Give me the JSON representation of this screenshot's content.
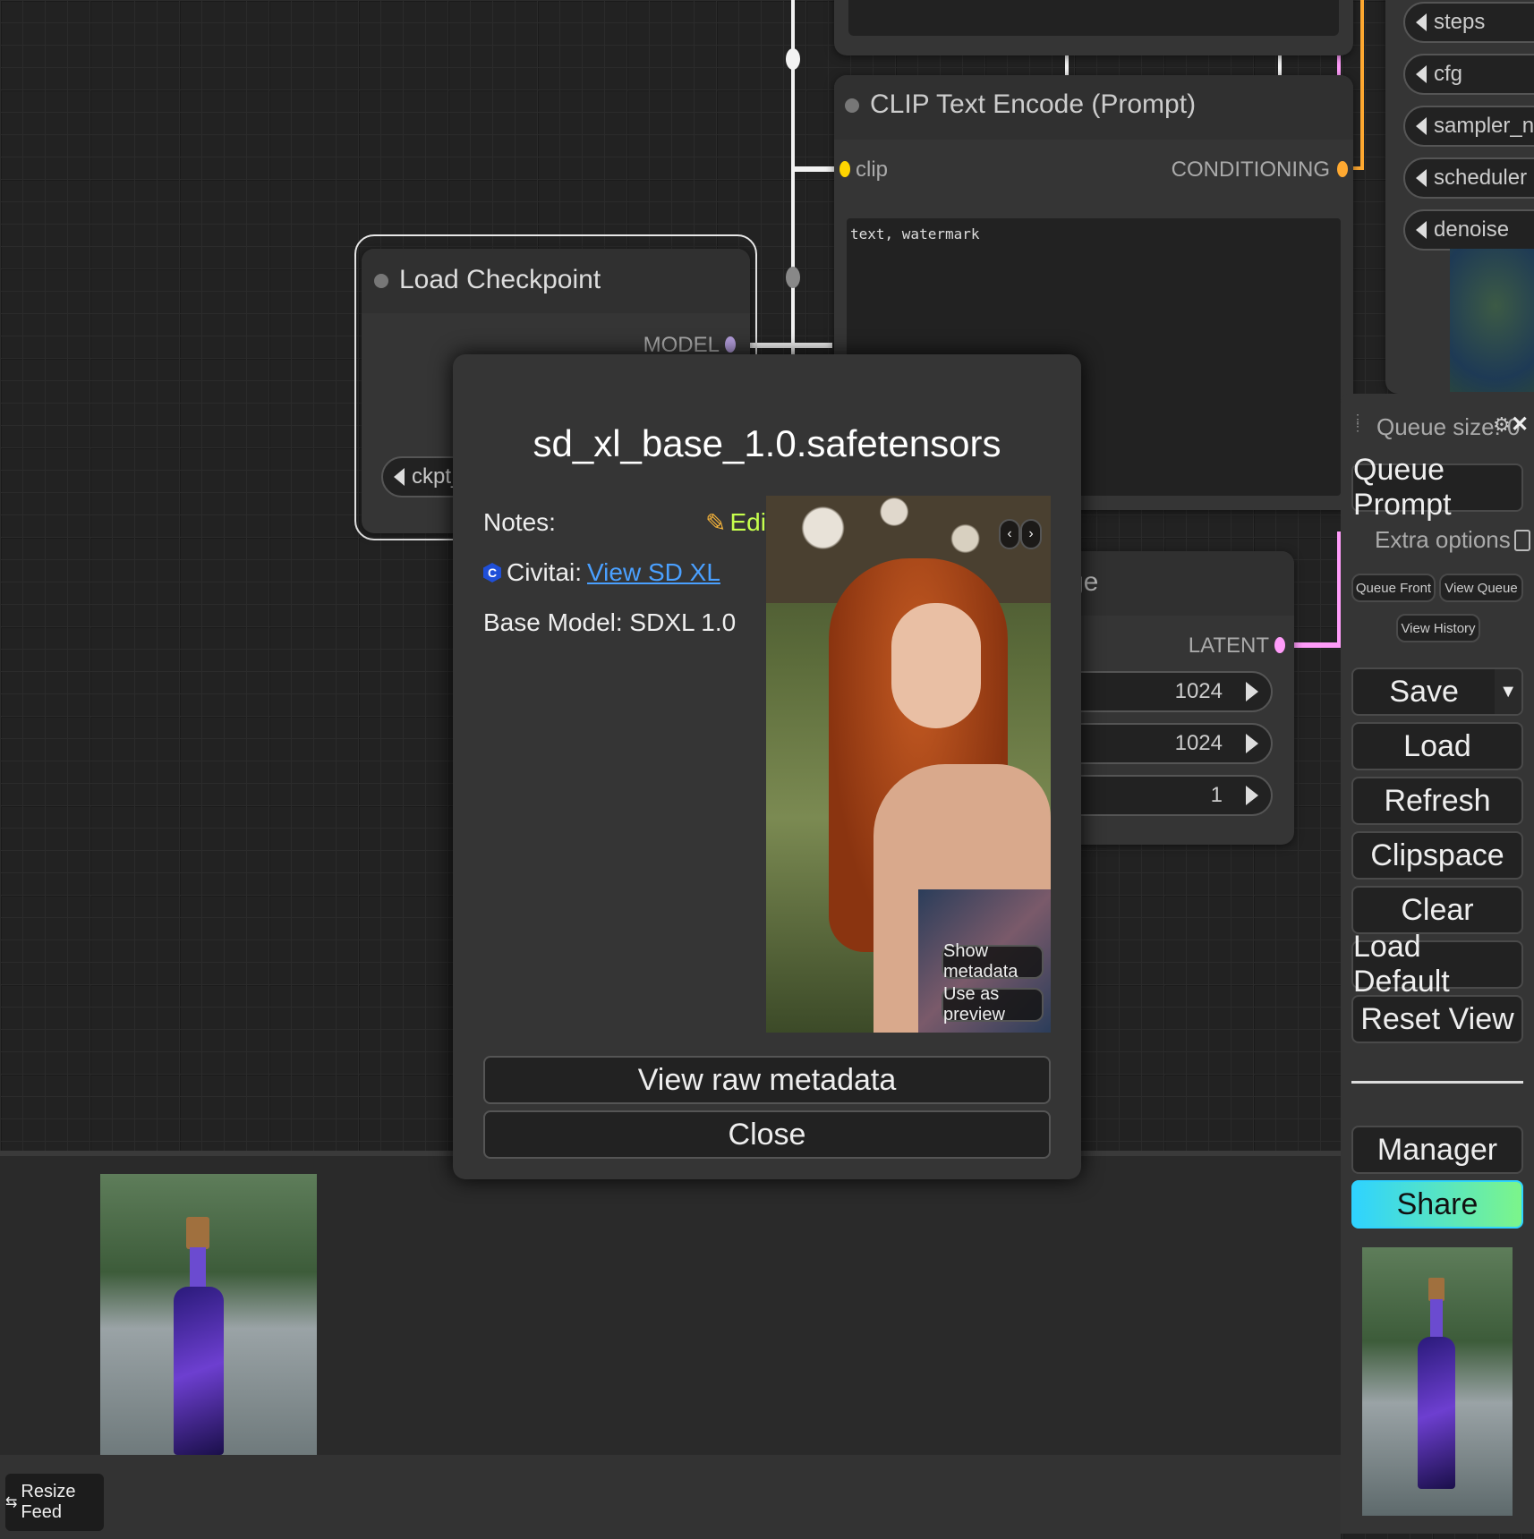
{
  "nodes": {
    "load_checkpoint": {
      "title": "Load Checkpoint",
      "output_model": "MODEL",
      "widget_ckpt": "ckpt_na"
    },
    "clip_text_encode": {
      "title": "CLIP Text Encode (Prompt)",
      "input_clip": "clip",
      "output_conditioning": "CONDITIONING",
      "text_value": "text, watermark"
    },
    "latent_image": {
      "title_partial": "ge",
      "output_latent": "LATENT",
      "widgets": [
        {
          "value": "1024"
        },
        {
          "value": "1024"
        },
        {
          "value": "1"
        }
      ]
    },
    "ksampler_inputs": [
      "steps",
      "cfg",
      "sampler_name",
      "scheduler",
      "denoise"
    ]
  },
  "dialog": {
    "title": "sd_xl_base_1.0.safetensors",
    "notes_label": "Notes:",
    "edit_label": "Edit",
    "edit_icon": "pencil-icon",
    "civitai_label": "Civitai:",
    "civitai_link": "View SD XL",
    "civitai_icon": "civitai-logo-icon",
    "base_model": "Base Model: SDXL 1.0",
    "prev_icon": "chevron-left-icon",
    "next_icon": "chevron-right-icon",
    "show_metadata": "Show metadata",
    "use_as_preview": "Use as preview",
    "view_raw": "View raw metadata",
    "close": "Close"
  },
  "menu": {
    "queue_size": "Queue size: 0",
    "queue_prompt": "Queue Prompt",
    "extra_options": "Extra options",
    "queue_front": "Queue Front",
    "view_queue": "View Queue",
    "view_history": "View History",
    "save": "Save",
    "load": "Load",
    "refresh": "Refresh",
    "clipspace": "Clipspace",
    "clear": "Clear",
    "load_default": "Load Default",
    "reset_view": "Reset View",
    "manager": "Manager",
    "share": "Share",
    "settings_icon": "gear-icon",
    "close_icon": "close-icon",
    "drag_icon": "drag-handle-icon"
  },
  "feed": {
    "resize_label": "Resize Feed",
    "resize_icon": "resize-arrows-icon"
  },
  "colors": {
    "clip_port": "#ffd500",
    "conditioning_port": "#ffa931",
    "latent_port": "#ff9cf9",
    "model_port": "#b39ddb",
    "edit_text": "#c6ff4d",
    "link": "#4aa0ff",
    "share_gradient_start": "#2fd3ff",
    "share_gradient_end": "#7cf58a"
  }
}
